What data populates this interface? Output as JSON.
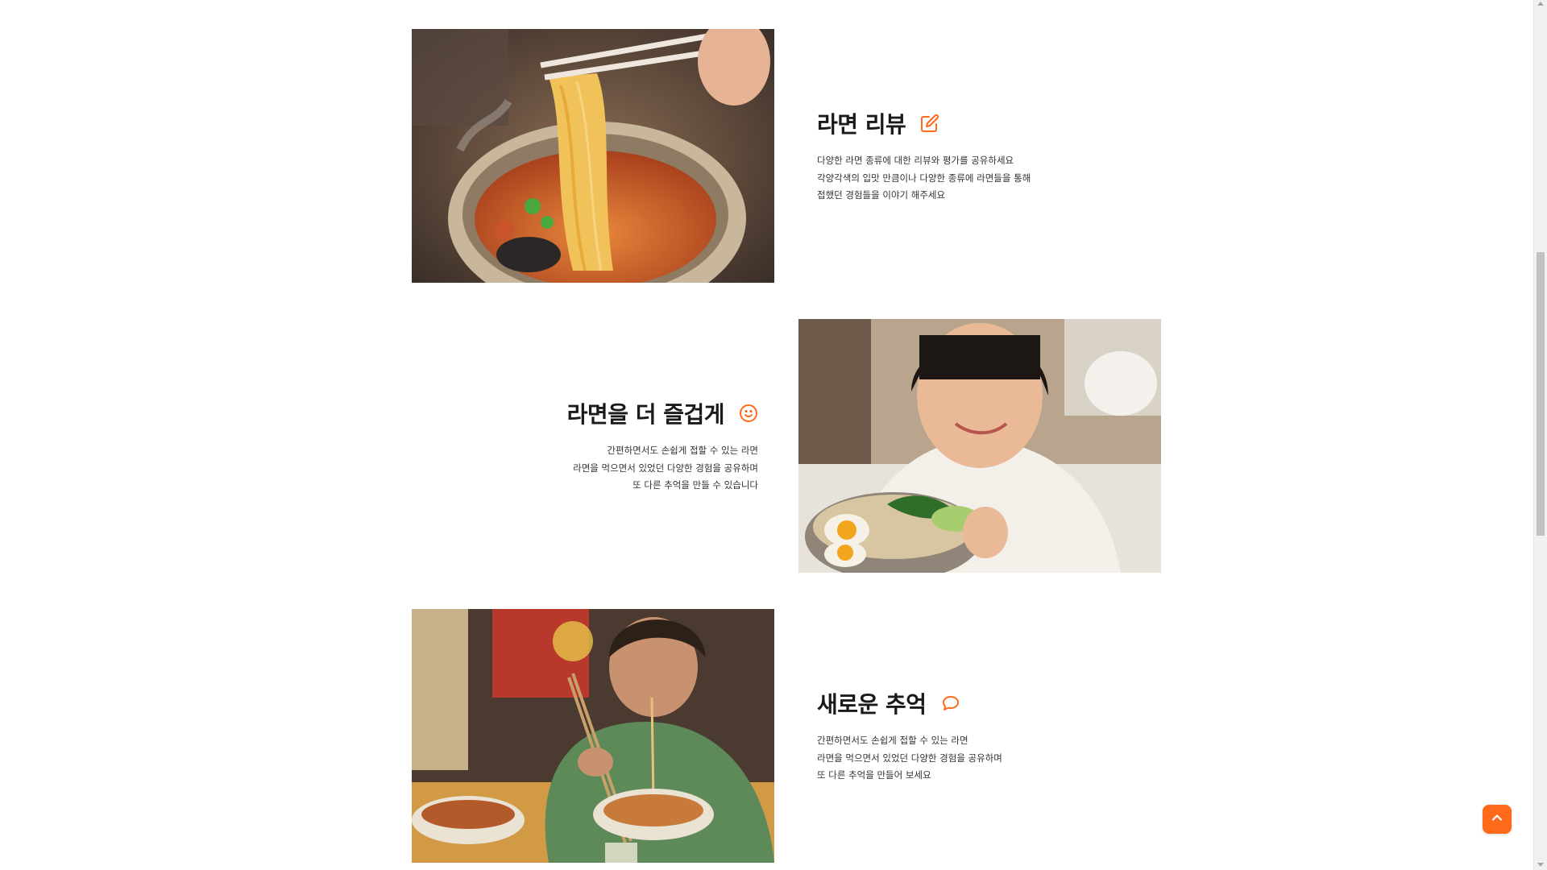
{
  "colors": {
    "accent": "#ff6a1a",
    "title": "#1a1a1a",
    "text": "#333333",
    "background": "#ffffff"
  },
  "sections": [
    {
      "title": "라면 리뷰",
      "icon": "pencil-square-icon",
      "image": "ramen-noodles-chopsticks-photo",
      "lines": [
        "다양한 라면 종류에 대한 리뷰와 평가를 공유하세요",
        "각양각색의 입맛 만큼이나 다양한 종류에 라면들을 통해",
        "접했던 경험들을 이야기 해주세요"
      ]
    },
    {
      "title": "라면을 더 즐겁게",
      "icon": "smile-icon",
      "image": "woman-holding-ramen-bowl-photo",
      "lines": [
        "간편하면서도 손쉽게 접할 수 있는 라면",
        "라면을 먹으면서 있었던 다양한 경험을 공유하며",
        "또 다른 추억을 만들 수 있습니다"
      ]
    },
    {
      "title": "새로운 추억",
      "icon": "chat-bubble-icon",
      "image": "man-eating-noodles-photo",
      "lines": [
        "간편하면서도 손쉽게 접할 수 있는 라면",
        "라면을 먹으면서 있었던 다양한 경험을 공유하며",
        "또 다른 추억을 만들어 보세요"
      ]
    }
  ],
  "scroll_top_button": {
    "icon": "chevron-up-icon"
  }
}
